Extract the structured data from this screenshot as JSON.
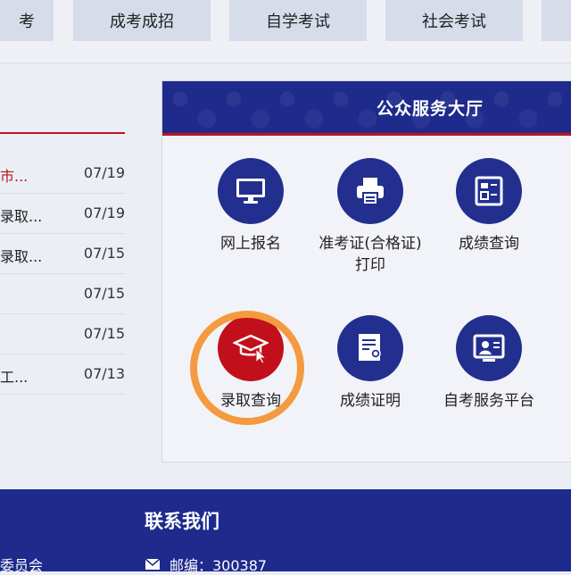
{
  "nav": {
    "items": [
      {
        "label": "考"
      },
      {
        "label": "成考成招"
      },
      {
        "label": "自学考试"
      },
      {
        "label": "社会考试"
      },
      {
        "label": ""
      }
    ]
  },
  "news": {
    "items": [
      {
        "title": "市...",
        "date": "07/19"
      },
      {
        "title": "录取...",
        "date": "07/19"
      },
      {
        "title": "录取...",
        "date": "07/15"
      },
      {
        "title": "",
        "date": "07/15"
      },
      {
        "title": "",
        "date": "07/15"
      },
      {
        "title": "工...",
        "date": "07/13"
      }
    ]
  },
  "services": {
    "title": "公众服务大厅",
    "items": [
      {
        "label": "网上报名",
        "icon": "monitor-icon"
      },
      {
        "label": "准考证(合格证)打印",
        "icon": "printer-icon"
      },
      {
        "label": "成绩查询",
        "icon": "score-report-icon"
      },
      {
        "label": "录取查询",
        "icon": "graduation-cap-cursor-icon"
      },
      {
        "label": "成绩证明",
        "icon": "certificate-document-icon"
      },
      {
        "label": "自考服务平台",
        "icon": "service-platform-icon"
      }
    ]
  },
  "footer": {
    "title": "联系我们",
    "left_text": "委员会",
    "postcode": "邮编：300387",
    "mail_icon": "envelope-icon"
  },
  "colors": {
    "primary": "#1e2a8c",
    "accent": "#c20f1c",
    "highlight": "#f59a3e"
  }
}
